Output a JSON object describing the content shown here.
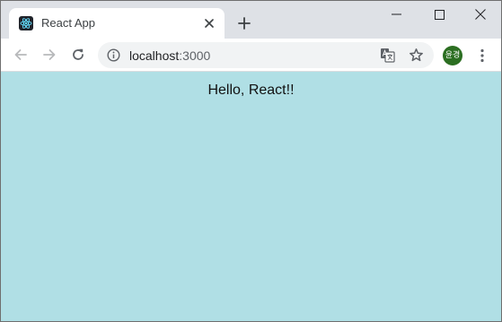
{
  "tab": {
    "title": "React App"
  },
  "address_bar": {
    "host": "localhost",
    "port": ":3000"
  },
  "profile": {
    "initials": "윤경"
  },
  "page": {
    "heading": "Hello, React!!",
    "background_color": "#b0dfe5"
  },
  "icons": {
    "favicon": "react-logo-icon",
    "tab_close": "close-icon",
    "new_tab": "plus-icon",
    "minimize": "minimize-icon",
    "maximize": "maximize-icon",
    "close": "window-close-icon",
    "back": "arrow-left-icon",
    "forward": "arrow-right-icon",
    "reload": "reload-icon",
    "site_info": "info-icon",
    "translate": "translate-icon",
    "bookmark": "star-icon",
    "menu": "kebab-menu-icon"
  },
  "colors": {
    "tabstrip": "#dee1e6",
    "omnibox": "#f1f3f4",
    "avatar": "#2b6e21",
    "react_blue": "#61dafb"
  }
}
